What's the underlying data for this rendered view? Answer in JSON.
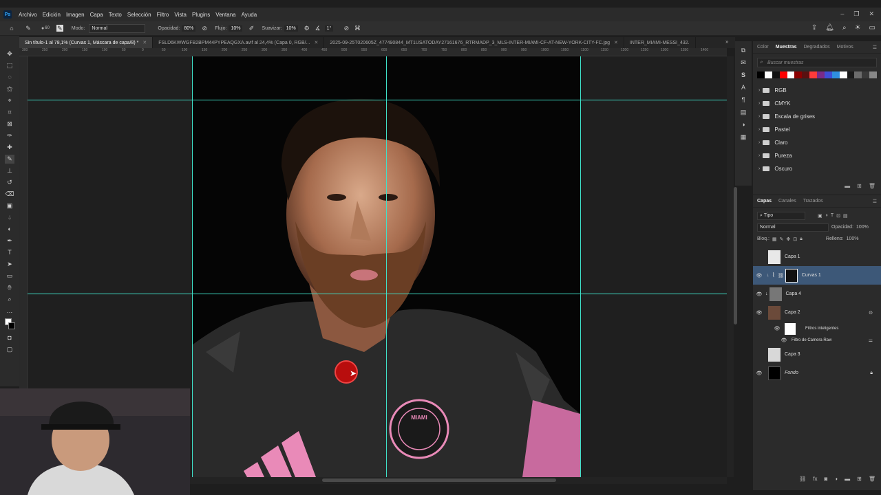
{
  "menu": [
    "Archivo",
    "Edición",
    "Imagen",
    "Capa",
    "Texto",
    "Selección",
    "Filtro",
    "Vista",
    "Plugins",
    "Ventana",
    "Ayuda"
  ],
  "options": {
    "brush_size": "60",
    "mode_label": "Modo:",
    "mode_value": "Normal",
    "opacity_label": "Opacidad:",
    "opacity_value": "80%",
    "flow_label": "Flujo:",
    "flow_value": "10%",
    "smooth_label": "Suavizar:",
    "smooth_value": "10%",
    "angle_value": "1°"
  },
  "tabs": [
    "Sin título-1 al 78,1% (Curvas 1, Máscara de capa/8) *",
    "FSLD6KWWGFB2BPM44PYPEAQGXA.avif al 24,4% (Capa 0, RGB/...",
    "2025-09-25T020605Z_477490844_MT1USATODAY27161676_RTRMADP_3_MLS-INTER-MIAMI-CF-AT-NEW-YORK-CITY-FC.jpg",
    "INTER_MIAMI-MESSI_432."
  ],
  "ruler_ticks": [
    "300",
    "250",
    "200",
    "150",
    "100",
    "50",
    "0",
    "50",
    "100",
    "150",
    "200",
    "250",
    "300",
    "350",
    "400",
    "450",
    "500",
    "550",
    "600",
    "650",
    "700",
    "750",
    "800",
    "850",
    "900",
    "950",
    "1000",
    "1050",
    "1100",
    "1150",
    "1200",
    "1250",
    "1300",
    "1350",
    "1400"
  ],
  "swatches_panel": {
    "tabs": [
      "Color",
      "Muestras",
      "Degradados",
      "Motivos"
    ],
    "active_tab": "Muestras",
    "search_placeholder": "Buscar muestras",
    "colors": [
      "#000000",
      "#ffffff",
      "#111111",
      "#ff0000",
      "#ffffff",
      "#8b0000",
      "#5a1010",
      "#ff3b3b",
      "#7a2b8a",
      "#3f4ed8",
      "#2f8fe0",
      "#ffffff",
      "#1b1b1b",
      "#6c6c6c",
      "#3a3a3a",
      "#888888"
    ],
    "folders": [
      "RGB",
      "CMYK",
      "Escala de grises",
      "Pastel",
      "Claro",
      "Pureza",
      "Oscuro"
    ]
  },
  "layers_panel": {
    "tabs": [
      "Capas",
      "Canales",
      "Trazados"
    ],
    "active_tab": "Capas",
    "filter_kind": "Tipo",
    "blend_mode": "Normal",
    "opacity_label": "Opacidad:",
    "opacity_value": "100%",
    "lock_label": "Bloq.:",
    "fill_label": "Relleno:",
    "fill_value": "100%",
    "layers": [
      {
        "name": "Capa 1",
        "visible": false,
        "active": false
      },
      {
        "name": "Curvas 1",
        "visible": true,
        "active": true
      },
      {
        "name": "Capa 4",
        "visible": true,
        "active": false
      },
      {
        "name": "Capa 2",
        "visible": true,
        "active": false
      },
      {
        "name": "Filtros inteligentes",
        "visible": true,
        "active": false
      },
      {
        "name": "Filtro de Camera Raw",
        "visible": true,
        "active": false
      },
      {
        "name": "Capa 3",
        "visible": false,
        "active": false
      },
      {
        "name": "Fondo",
        "visible": true,
        "active": false
      }
    ]
  },
  "photo": {
    "crest_text": "MIAMI"
  }
}
